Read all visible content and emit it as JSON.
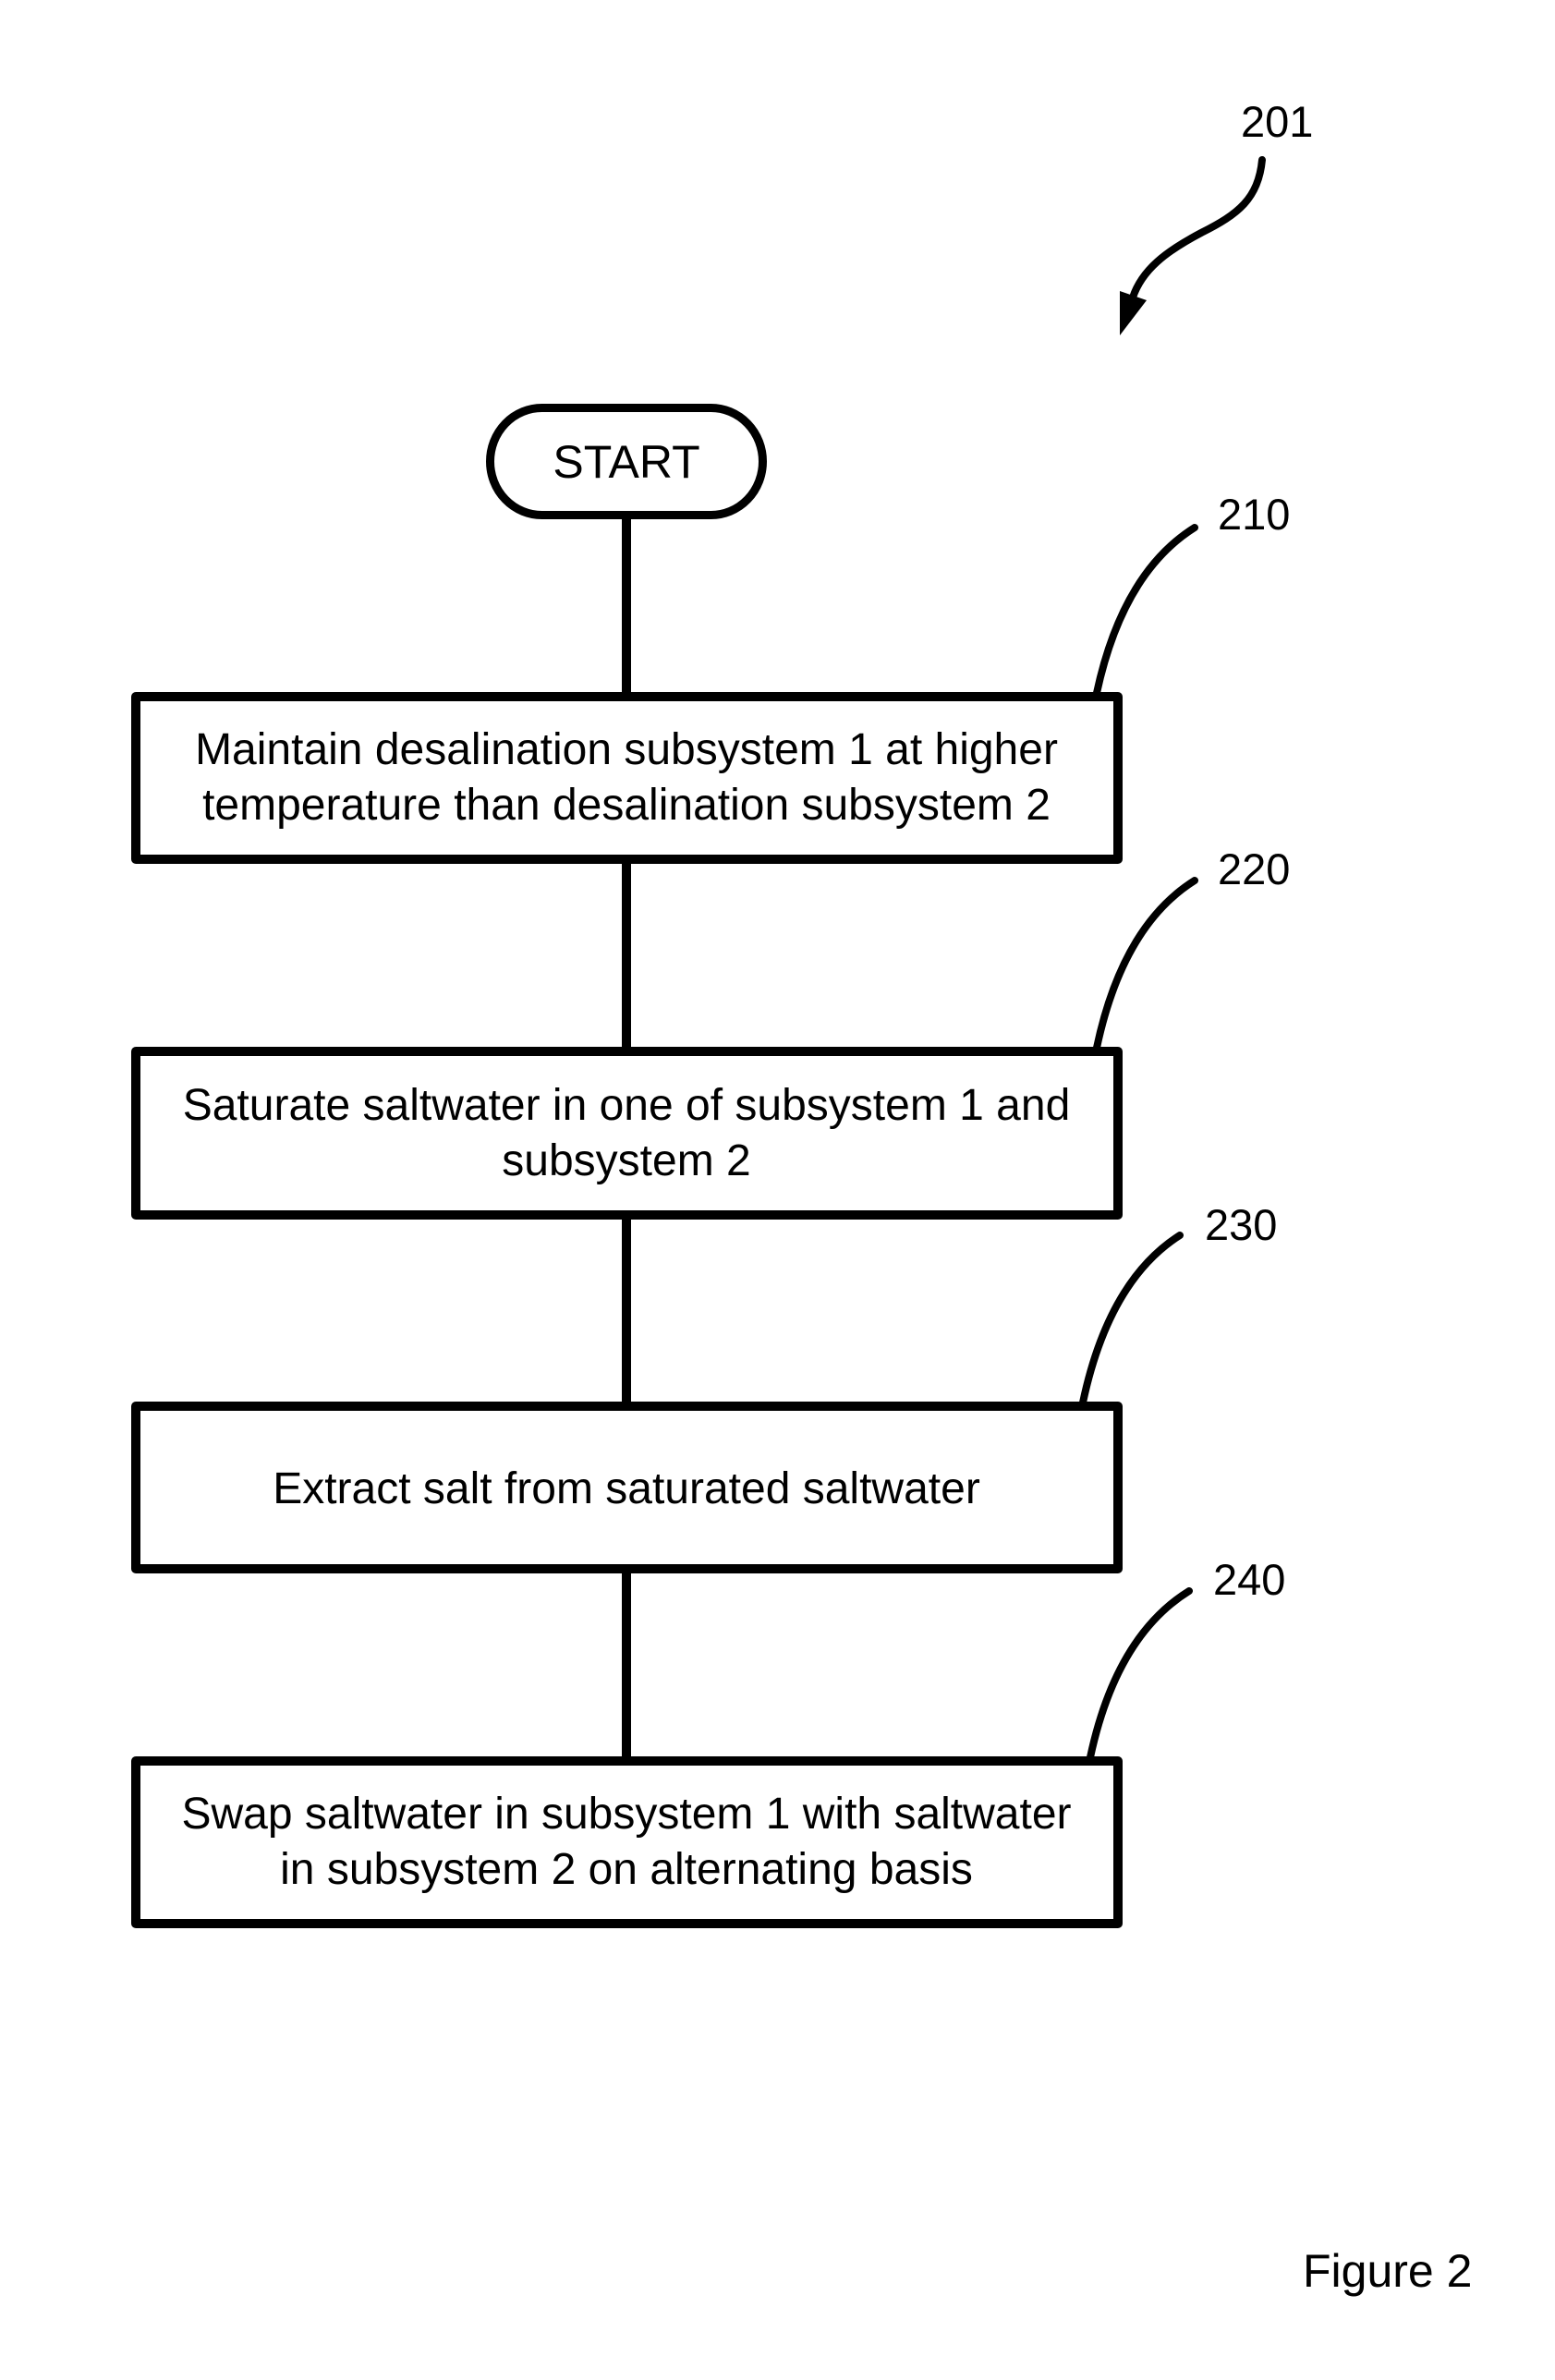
{
  "figure": {
    "caption": "Figure 2",
    "reference_numeral": "201",
    "colors": {
      "line": "#000000",
      "background": "#ffffff"
    }
  },
  "flowchart": {
    "start": {
      "label": "START"
    },
    "steps": [
      {
        "ref": "210",
        "lines": [
          "Maintain desalination subsystem 1 at higher",
          "temperature than desalination subsystem 2"
        ]
      },
      {
        "ref": "220",
        "lines": [
          "Saturate saltwater in one of subsystem 1 and",
          "subsystem 2"
        ]
      },
      {
        "ref": "230",
        "lines": [
          "Extract salt from saturated saltwater"
        ]
      },
      {
        "ref": "240",
        "lines": [
          "Swap saltwater in subsystem 1 with saltwater",
          "in subsystem 2 on alternating basis"
        ]
      }
    ]
  }
}
